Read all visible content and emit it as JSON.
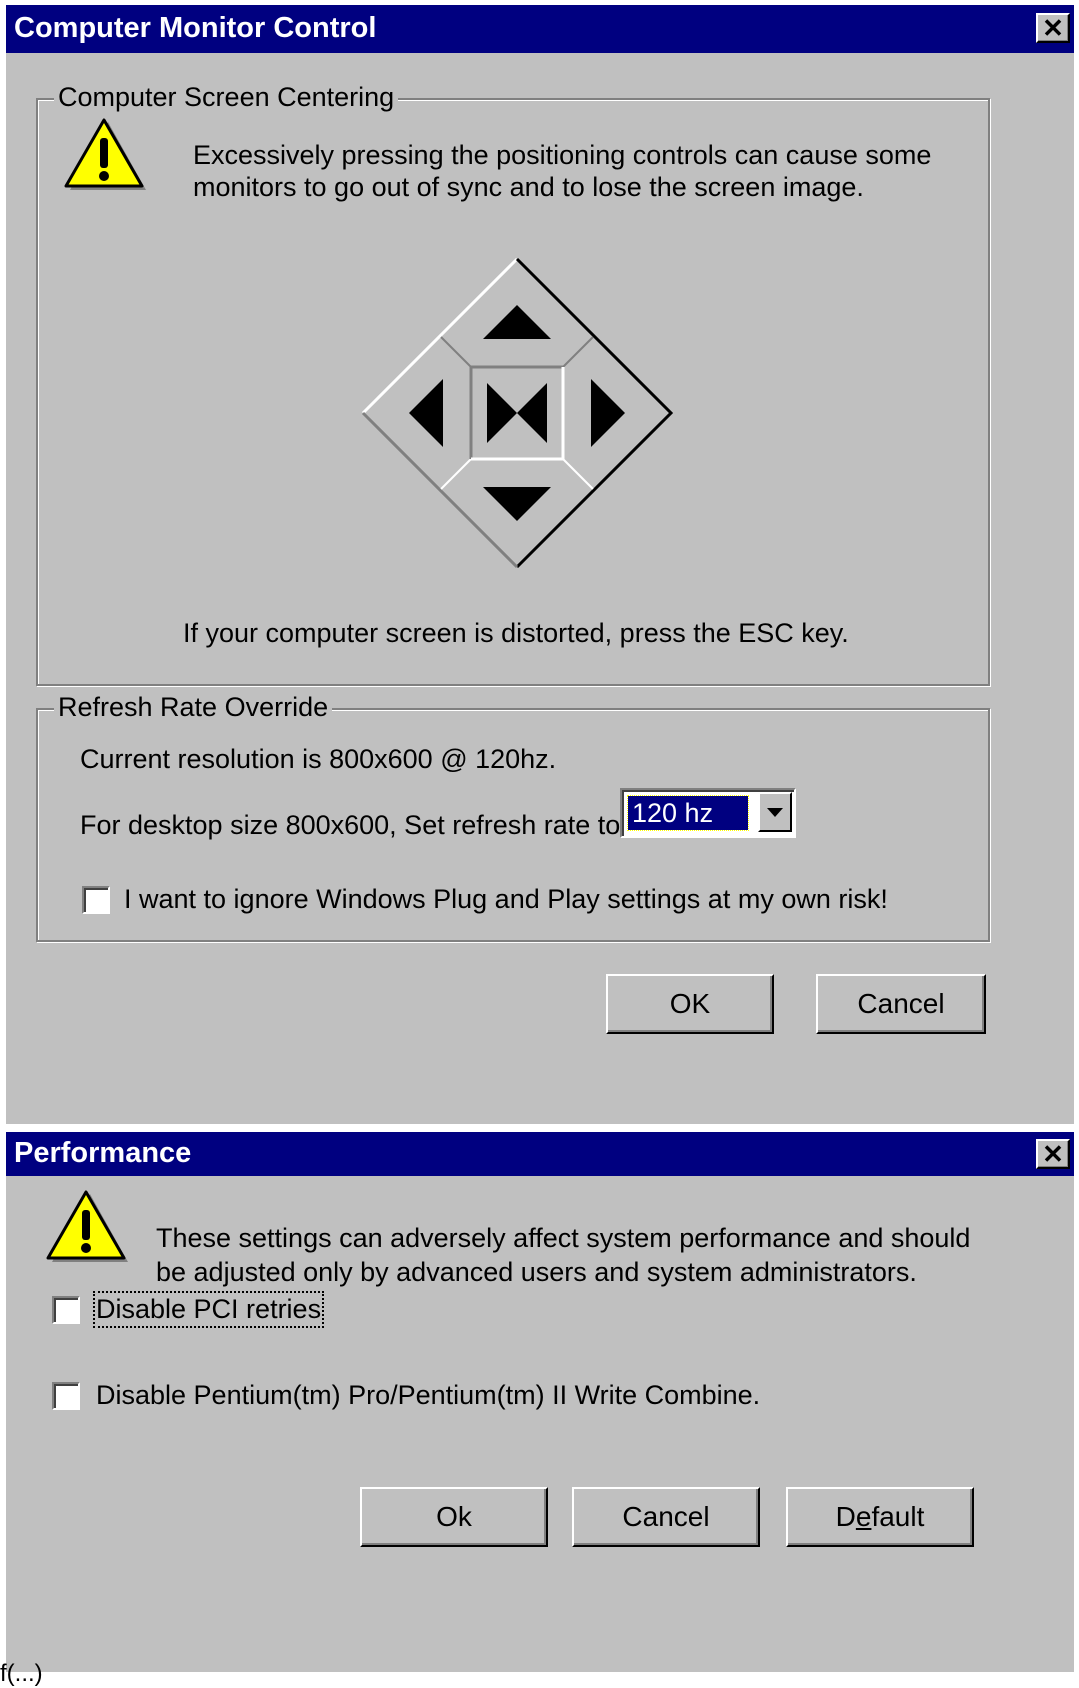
{
  "monitor_dialog": {
    "title": "Computer Monitor Control",
    "close_label": "✕",
    "centering": {
      "legend": "Computer Screen Centering",
      "warning_line1": "Excessively pressing the positioning controls can cause some",
      "warning_line2": "monitors to go out of sync and to lose the screen image.",
      "esc_hint": "If your computer screen is distorted, press the ESC key."
    },
    "refresh": {
      "legend": "Refresh Rate Override",
      "current_resolution": "Current resolution is 800x600 @ 120hz.",
      "set_rate_label": "For desktop size 800x600, Set refresh rate to",
      "selected_rate": "120 hz",
      "ignore_pnp_label": "I want to ignore Windows Plug and Play settings at my own risk!",
      "ignore_pnp_checked": false
    },
    "ok_label": "OK",
    "cancel_label": "Cancel"
  },
  "performance_dialog": {
    "title": "Performance",
    "close_label": "✕",
    "warning_line1": "These settings can adversely affect system performance and should",
    "warning_line2": "be adjusted only by advanced users and system administrators.",
    "disable_pci_label": "Disable PCI retries",
    "disable_pci_checked": false,
    "disable_write_combine_label": "Disable Pentium(tm) Pro/Pentium(tm) II Write Combine.",
    "disable_write_combine_checked": false,
    "ok_label": "Ok",
    "cancel_label": "Cancel",
    "default_label_pre": "D",
    "default_label_mnemonic": "e",
    "default_label_post": "fault"
  },
  "footer_fragment": "f(...)"
}
